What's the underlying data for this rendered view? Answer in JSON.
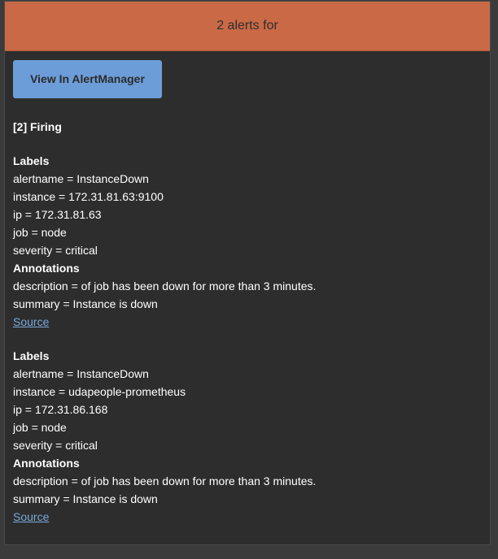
{
  "header": {
    "title": "2 alerts for"
  },
  "button": {
    "label": "View In AlertManager"
  },
  "firing_title": "[2] Firing",
  "alerts": [
    {
      "labels_heading": "Labels",
      "labels": [
        "alertname = InstanceDown",
        "instance = 172.31.81.63:9100",
        "ip = 172.31.81.63",
        "job = node",
        "severity = critical"
      ],
      "annotations_heading": "Annotations",
      "annotations": [
        "description = of job has been down for more than 3 minutes.",
        "summary = Instance is down"
      ],
      "source_label": "Source"
    },
    {
      "labels_heading": "Labels",
      "labels": [
        "alertname = InstanceDown",
        "instance = udapeople-prometheus",
        "ip = 172.31.86.168",
        "job = node",
        "severity = critical"
      ],
      "annotations_heading": "Annotations",
      "annotations": [
        "description = of job has been down for more than 3 minutes.",
        "summary = Instance is down"
      ],
      "source_label": "Source"
    }
  ]
}
